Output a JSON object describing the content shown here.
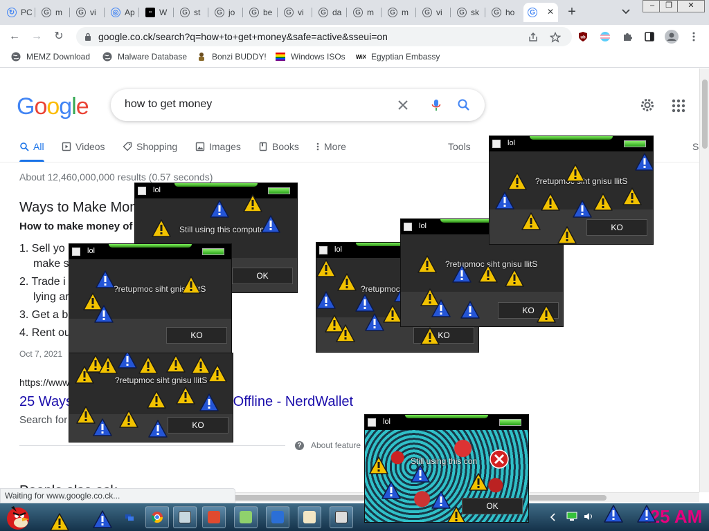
{
  "browser": {
    "tabs": [
      {
        "label": "PC",
        "icon": "pc-icon"
      },
      {
        "label": "m",
        "icon": "google-icon"
      },
      {
        "label": "vi",
        "icon": "google-icon"
      },
      {
        "label": "Ap",
        "icon": "globe-icon"
      },
      {
        "label": "W",
        "icon": "black-square-icon"
      },
      {
        "label": "st",
        "icon": "google-icon"
      },
      {
        "label": "jo",
        "icon": "google-icon"
      },
      {
        "label": "be",
        "icon": "google-icon"
      },
      {
        "label": "vi",
        "icon": "google-icon"
      },
      {
        "label": "da",
        "icon": "google-icon"
      },
      {
        "label": "m",
        "icon": "google-icon"
      },
      {
        "label": "m",
        "icon": "google-icon"
      },
      {
        "label": "vi",
        "icon": "google-icon"
      },
      {
        "label": "sk",
        "icon": "google-icon"
      },
      {
        "label": "ho",
        "icon": "google-icon"
      },
      {
        "label": "G",
        "icon": "google-icon",
        "active": true
      }
    ],
    "url": "google.co.ck/search?q=how+to+get+money&safe=active&sseui=on",
    "bookmarks": [
      {
        "label": "MEMZ Download",
        "icon": "globe-icon"
      },
      {
        "label": "Malware Database",
        "icon": "globe-icon"
      },
      {
        "label": "Bonzi BUDDY!",
        "icon": "bonzi-icon"
      },
      {
        "label": "Windows ISOs",
        "icon": "rainbow-flag-icon"
      },
      {
        "label": "Egyptian Embassy",
        "icon": "wix-icon"
      }
    ],
    "status": "Waiting for www.google.co.ck..."
  },
  "google": {
    "logo": [
      "G",
      "o",
      "o",
      "g",
      "l",
      "e"
    ],
    "logo_colors": [
      "#4285f4",
      "#ea4335",
      "#fbbc05",
      "#4285f4",
      "#34a853",
      "#ea4335"
    ],
    "query": "how to get money",
    "tabs": [
      "All",
      "Videos",
      "Shopping",
      "Images",
      "Books",
      "More"
    ],
    "tools": "Tools",
    "s_cut": "S",
    "stats": "About 12,460,000,000 results (0.57 seconds)",
    "snippet": {
      "title": "Ways to Make Mon",
      "subtitle": "How to make money of",
      "items": [
        "1. Sell yo",
        "make s",
        "2. Trade i",
        "lying ar",
        "3. Get a b",
        "4. Rent ou"
      ],
      "date": "Oct 7, 2021",
      "cite": "https://www",
      "link": "25 Ways",
      "link_tail": "d Offline - NerdWallet",
      "desc": "Search for",
      "about": "About feature",
      "people": "People also ask"
    }
  },
  "virus_windows": [
    {
      "title": "lol",
      "message": "Still using this computer?",
      "button": "OK"
    },
    {
      "title": "lol",
      "message": "?retupmoc siht gnisu llitS",
      "button": "KO"
    },
    {
      "title": "lol",
      "message": "?retupmoc siht gnisu llitS",
      "button": "KO"
    },
    {
      "title": "lol",
      "message": "?retupmoc",
      "button": "KO"
    },
    {
      "title": "lol",
      "message": "?retupmoc siht gnisu llitS",
      "button": "KO"
    },
    {
      "title": "lol",
      "message": "?retupmoc siht gnisu llitS",
      "button": "KO"
    },
    {
      "title": "lol",
      "message": "Still using this con",
      "button": "OK"
    }
  ],
  "taskbar": {
    "clock": ":25 AM"
  },
  "colors": {
    "accent": "#1a73e8",
    "link": "#1a0dab",
    "clock": "#e6007e",
    "warn_yellow": "#f2c200",
    "warn_blue": "#2455d6"
  }
}
